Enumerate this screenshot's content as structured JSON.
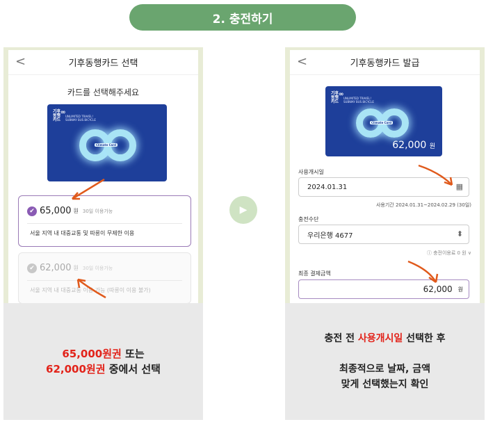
{
  "title": "2. 충전하기",
  "left": {
    "header_title": "기후동행카드 선택",
    "back_label": "<",
    "heading": "카드를 선택해주세요",
    "card": {
      "brand_line1": "기후",
      "brand_line2": "동행",
      "brand_line3": "카드",
      "sub1": "UNLIMITED TRAVEL!",
      "sub2": "SUBWAY BUS BICYCLE",
      "center_label": "Climate Card"
    },
    "options": [
      {
        "amount": "65,000",
        "won": "원",
        "duration": "30일 이용가능",
        "desc": "서울 지역 내 대중교통 및 따릉이 무제한 이용",
        "selected": true
      },
      {
        "amount": "62,000",
        "won": "원",
        "duration": "30일 이용가능",
        "desc": "서울 지역 내 대중교통 이용 가능 (따릉이 이용 불가)",
        "selected": false
      }
    ],
    "caption": {
      "line1_red": "65,000원권",
      "line1_black": " 또는",
      "line2_red": "62,000원권",
      "line2_black": " 중에서 선택"
    }
  },
  "right": {
    "header_title": "기후동행카드 발급",
    "back_label": "<",
    "card": {
      "brand_line1": "기후",
      "brand_line2": "동행",
      "brand_line3": "카드",
      "sub1": "UNLIMITED TRAVEL!",
      "sub2": "SUBWAY BUS BICYCLE",
      "center_label": "Climate Card",
      "price": "62,000",
      "won": "원"
    },
    "start_label": "사용개시일",
    "start_value": "2024.01.31",
    "period_text": "사용기간  2024.01.31~2024.02.29 (30일)",
    "method_label": "충전수단",
    "method_value": "우리은행 4677",
    "fee_text": "ⓘ 충전이용료 0 원 ∨",
    "total_label": "최종 결제금액",
    "total_value": "62,000",
    "total_won": "원",
    "caption": {
      "line1_a": "충전 전 ",
      "line1_red": "사용개시일",
      "line1_b": " 선택한 후",
      "line2": "최종적으로 날짜, 금액",
      "line3": "맞게 선택했는지 확인"
    }
  },
  "colors": {
    "accent_green": "#6aa56f",
    "card_blue": "#1e3f9a",
    "select_purple": "#8a5bb4",
    "arrow": "#e05a1c",
    "highlight_red": "#e2231a"
  }
}
